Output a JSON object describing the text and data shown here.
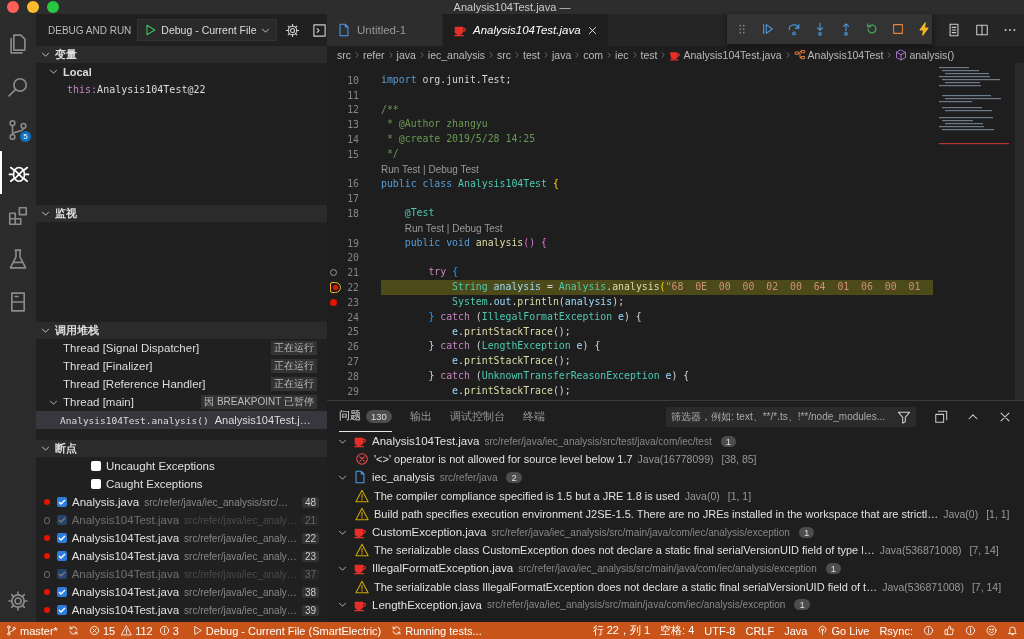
{
  "window": {
    "title": "Analysis104Test.java —"
  },
  "activity_bar": {
    "items": [
      {
        "selected": false
      },
      {
        "selected": false
      },
      {
        "selected": false,
        "badge": "5"
      },
      {
        "selected": true
      },
      {
        "selected": false
      },
      {
        "selected": false
      },
      {
        "selected": false
      }
    ]
  },
  "sidebar": {
    "title": "DEBUG AND RUN",
    "configuration": "Debug - Current File",
    "variables": {
      "title": "变量",
      "expanded": true,
      "scopes": [
        {
          "name": "Local",
          "expanded": true,
          "variables": [
            {
              "name": "this:",
              "value": "Analysis104Test@22"
            }
          ]
        }
      ]
    },
    "watch": {
      "title": "监视",
      "expanded": true
    },
    "call_stack": {
      "title": "调用堆栈",
      "expanded": true,
      "threads": [
        {
          "name": "Thread [Signal Dispatcher]",
          "status": "正在运行"
        },
        {
          "name": "Thread [Finalizer]",
          "status": "正在运行"
        },
        {
          "name": "Thread [Reference Handler]",
          "status": "正在运行"
        },
        {
          "name": "Thread [main]",
          "status": "因 BREAKPOINT 已暂停",
          "expanded": true,
          "frames": [
            {
              "name": "Analysis104Test.analysis()",
              "source": "Analysis104Test.j…",
              "selected": true
            }
          ]
        }
      ]
    },
    "breakpoints": {
      "title": "断点",
      "expanded": true,
      "exceptions": [
        {
          "label": "Uncaught Exceptions",
          "checked": false
        },
        {
          "label": "Caught Exceptions",
          "checked": false
        }
      ],
      "items": [
        {
          "file": "Analysis.java",
          "path": "src/refer/java/iec_analysis/src/…",
          "line": "48",
          "checked": true,
          "disabled": false
        },
        {
          "file": "Analysis104Test.java",
          "path": "src/refer/java/iec_analy…",
          "line": "21",
          "checked": true,
          "disabled": true
        },
        {
          "file": "Analysis104Test.java",
          "path": "src/refer/java/iec_analy…",
          "line": "22",
          "checked": true,
          "disabled": false
        },
        {
          "file": "Analysis104Test.java",
          "path": "src/refer/java/iec_analy…",
          "line": "23",
          "checked": true,
          "disabled": false
        },
        {
          "file": "Analysis104Test.java",
          "path": "src/refer/java/iec_analy…",
          "line": "37",
          "checked": true,
          "disabled": true
        },
        {
          "file": "Analysis104Test.java",
          "path": "src/refer/java/iec_analy…",
          "line": "38",
          "checked": true,
          "disabled": false
        },
        {
          "file": "Analysis104Test.java",
          "path": "src/refer/java/iec_analy…",
          "line": "39",
          "checked": true,
          "disabled": false
        }
      ]
    }
  },
  "tabs": [
    {
      "label": "Untitled-1",
      "kind": "text",
      "selected": false,
      "preview": false
    },
    {
      "label": "Analysis104Test.java",
      "kind": "java",
      "selected": true,
      "preview": true
    }
  ],
  "breadcrumb": [
    {
      "kind": "folder",
      "text": "src"
    },
    {
      "kind": "folder",
      "text": "refer"
    },
    {
      "kind": "folder",
      "text": "java"
    },
    {
      "kind": "folder",
      "text": "iec_analysis"
    },
    {
      "kind": "folder",
      "text": "src"
    },
    {
      "kind": "folder",
      "text": "test"
    },
    {
      "kind": "folder",
      "text": "java"
    },
    {
      "kind": "folder",
      "text": "com"
    },
    {
      "kind": "folder",
      "text": "iec"
    },
    {
      "kind": "folder",
      "text": "test"
    },
    {
      "kind": "java",
      "text": "Analysis104Test.java"
    },
    {
      "kind": "class",
      "text": "Analysis104Test"
    },
    {
      "kind": "method",
      "text": "analysis()"
    }
  ],
  "code": [
    {
      "number": "10",
      "kind": "plain",
      "segments": [
        {
          "kind": "kw",
          "text": "import"
        },
        {
          "kind": "plain",
          "text": " org.junit.Test;"
        }
      ]
    },
    {
      "number": "11",
      "kind": "plain"
    },
    {
      "number": "12",
      "kind": "plain",
      "segments": [
        {
          "kind": "cmt",
          "text": "/**"
        }
      ]
    },
    {
      "number": "13",
      "kind": "plain",
      "segments": [
        {
          "kind": "cmt",
          "text": " * @Author zhangyu"
        }
      ]
    },
    {
      "number": "14",
      "kind": "plain",
      "segments": [
        {
          "kind": "cmt",
          "text": " * @create 2019/5/28 14:25"
        }
      ]
    },
    {
      "number": "15",
      "kind": "plain",
      "segments": [
        {
          "kind": "cmt",
          "text": " */"
        }
      ]
    },
    {
      "number": "16",
      "kind": "plain",
      "codelens": "Run Test | Debug Test",
      "segments": [
        {
          "kind": "kw",
          "text": "public class"
        },
        {
          "kind": "type",
          "text": " Analysis104Test"
        },
        {
          "kind": "brace",
          "text": " {"
        }
      ]
    },
    {
      "number": "17",
      "kind": "plain"
    },
    {
      "number": "18",
      "kind": "plain",
      "segments": [
        {
          "kind": "type",
          "text": "    @Test"
        }
      ]
    },
    {
      "number": "19",
      "kind": "plain",
      "codelens": "Run Test | Debug Test",
      "segments": [
        {
          "kind": "kw",
          "text": "    public void"
        },
        {
          "kind": "fn",
          "text": " analysis"
        },
        {
          "kind": "brace2",
          "text": "() {"
        }
      ]
    },
    {
      "number": "20",
      "kind": "plain"
    },
    {
      "number": "21",
      "kind": "disabled_breakpoint",
      "segments": [
        {
          "kind": "ctl",
          "text": "        try"
        },
        {
          "kind": "brace3",
          "text": " {"
        }
      ]
    },
    {
      "number": "22",
      "kind": "paused",
      "segments": [
        {
          "kind": "type",
          "text": "            String"
        },
        {
          "kind": "var",
          "text": " analysis"
        },
        {
          "kind": "plain",
          "text": " = "
        },
        {
          "kind": "type",
          "text": "Analysis"
        },
        {
          "kind": "plain",
          "text": "."
        },
        {
          "kind": "fn",
          "text": "analysis"
        },
        {
          "kind": "brace",
          "text": "("
        },
        {
          "kind": "str",
          "text": "\"68  0E  00  00  02  00  64  01  06  00  01"
        }
      ]
    },
    {
      "number": "23",
      "kind": "breakpoint",
      "segments": [
        {
          "kind": "type",
          "text": "            System"
        },
        {
          "kind": "plain",
          "text": "."
        },
        {
          "kind": "var",
          "text": "out"
        },
        {
          "kind": "plain",
          "text": "."
        },
        {
          "kind": "fn",
          "text": "println"
        },
        {
          "kind": "plain",
          "text": "("
        },
        {
          "kind": "var",
          "text": "analysis"
        },
        {
          "kind": "plain",
          "text": ");"
        }
      ]
    },
    {
      "number": "24",
      "kind": "plain",
      "segments": [
        {
          "kind": "brace3",
          "text": "        }"
        },
        {
          "kind": "ctl",
          "text": " catch"
        },
        {
          "kind": "plain",
          "text": " ("
        },
        {
          "kind": "type",
          "text": "IllegalFormatException"
        },
        {
          "kind": "var",
          "text": " e"
        },
        {
          "kind": "plain",
          "text": ") {"
        }
      ]
    },
    {
      "number": "25",
      "kind": "plain",
      "segments": [
        {
          "kind": "var",
          "text": "            e"
        },
        {
          "kind": "plain",
          "text": "."
        },
        {
          "kind": "fn",
          "text": "printStackTrace"
        },
        {
          "kind": "plain",
          "text": "();"
        }
      ]
    },
    {
      "number": "26",
      "kind": "plain",
      "segments": [
        {
          "kind": "plain",
          "text": "        }"
        },
        {
          "kind": "ctl",
          "text": " catch"
        },
        {
          "kind": "plain",
          "text": " ("
        },
        {
          "kind": "type",
          "text": "LengthException"
        },
        {
          "kind": "var",
          "text": " e"
        },
        {
          "kind": "plain",
          "text": ") {"
        }
      ]
    },
    {
      "number": "27",
      "kind": "plain",
      "segments": [
        {
          "kind": "var",
          "text": "            e"
        },
        {
          "kind": "plain",
          "text": "."
        },
        {
          "kind": "fn",
          "text": "printStackTrace"
        },
        {
          "kind": "plain",
          "text": "();"
        }
      ]
    },
    {
      "number": "28",
      "kind": "plain",
      "segments": [
        {
          "kind": "plain",
          "text": "        }"
        },
        {
          "kind": "ctl",
          "text": " catch"
        },
        {
          "kind": "plain",
          "text": " ("
        },
        {
          "kind": "type",
          "text": "UnknownTransferReasonException"
        },
        {
          "kind": "var",
          "text": " e"
        },
        {
          "kind": "plain",
          "text": ") {"
        }
      ]
    },
    {
      "number": "29",
      "kind": "plain",
      "segments": [
        {
          "kind": "var",
          "text": "            e"
        },
        {
          "kind": "plain",
          "text": "."
        },
        {
          "kind": "fn",
          "text": "printStackTrace"
        },
        {
          "kind": "plain",
          "text": "();"
        }
      ]
    }
  ],
  "panel": {
    "tabs": [
      {
        "label": "问题",
        "badge": "130",
        "selected": true
      },
      {
        "label": "输出",
        "selected": false
      },
      {
        "label": "调试控制台",
        "selected": false
      },
      {
        "label": "终端",
        "selected": false
      }
    ],
    "filter": {
      "placeholder": "筛选器，例如: text、**/*.ts、!**/node_modules..."
    },
    "groups": [
      {
        "file": "Analysis104Test.java",
        "kind": "java",
        "path": "src/refer/java/iec_analysis/src/test/java/com/iec/test",
        "count": "1",
        "expanded": true,
        "problems": [
          {
            "kind": "error",
            "message": "'<>' operator is not allowed for source level below 1.7",
            "source": "Java(16778099)",
            "position": "[38, 85]"
          }
        ]
      },
      {
        "file": "iec_analysis",
        "kind": "project",
        "path": "src/refer/java",
        "count": "2",
        "expanded": true,
        "problems": [
          {
            "kind": "warning",
            "message": "The compiler compliance specified is 1.5 but a JRE 1.8 is used",
            "source": "Java(0)",
            "position": "[1, 1]"
          },
          {
            "kind": "warning",
            "message": "Build path specifies execution environment J2SE-1.5. There are no JREs installed in the workspace that are strictl…",
            "source": "Java(0)",
            "position": "[1, 1]"
          }
        ]
      },
      {
        "file": "CustomException.java",
        "kind": "java",
        "path": "src/refer/java/iec_analysis/src/main/java/com/iec/analysis/exception",
        "count": "1",
        "expanded": true,
        "problems": [
          {
            "kind": "warning",
            "message": "The serializable class CustomException does not declare a static final serialVersionUID field of type l…",
            "source": "Java(536871008)",
            "position": "[7, 14]"
          }
        ]
      },
      {
        "file": "IllegalFormatException.java",
        "kind": "java",
        "path": "src/refer/java/iec_analysis/src/main/java/com/iec/analysis/exception",
        "count": "1",
        "expanded": true,
        "problems": [
          {
            "kind": "warning",
            "message": "The serializable class IllegalFormatException does not declare a static final serialVersionUID field of t…",
            "source": "Java(536871008)",
            "position": "[7, 14]"
          }
        ]
      },
      {
        "file": "LengthException.java",
        "kind": "java",
        "path": "src/refer/java/iec_analysis/src/main/java/com/iec/analysis/exception",
        "count": "1",
        "expanded": true
      }
    ]
  },
  "status_bar": {
    "branch": "master*",
    "errors": "15",
    "warnings": "112",
    "infos": "3",
    "debug": "Debug - Current File (SmartElectric)",
    "task": "Running tests...",
    "right": [
      {
        "kind": "text",
        "text": "行 22，列 1"
      },
      {
        "kind": "text",
        "text": "空格: 4"
      },
      {
        "kind": "text",
        "text": "UTF-8"
      },
      {
        "kind": "text",
        "text": "CRLF"
      },
      {
        "kind": "text",
        "text": "Java"
      },
      {
        "kind": "live",
        "text": "Go Live"
      },
      {
        "kind": "text",
        "text": "Rsync:"
      }
    ]
  }
}
